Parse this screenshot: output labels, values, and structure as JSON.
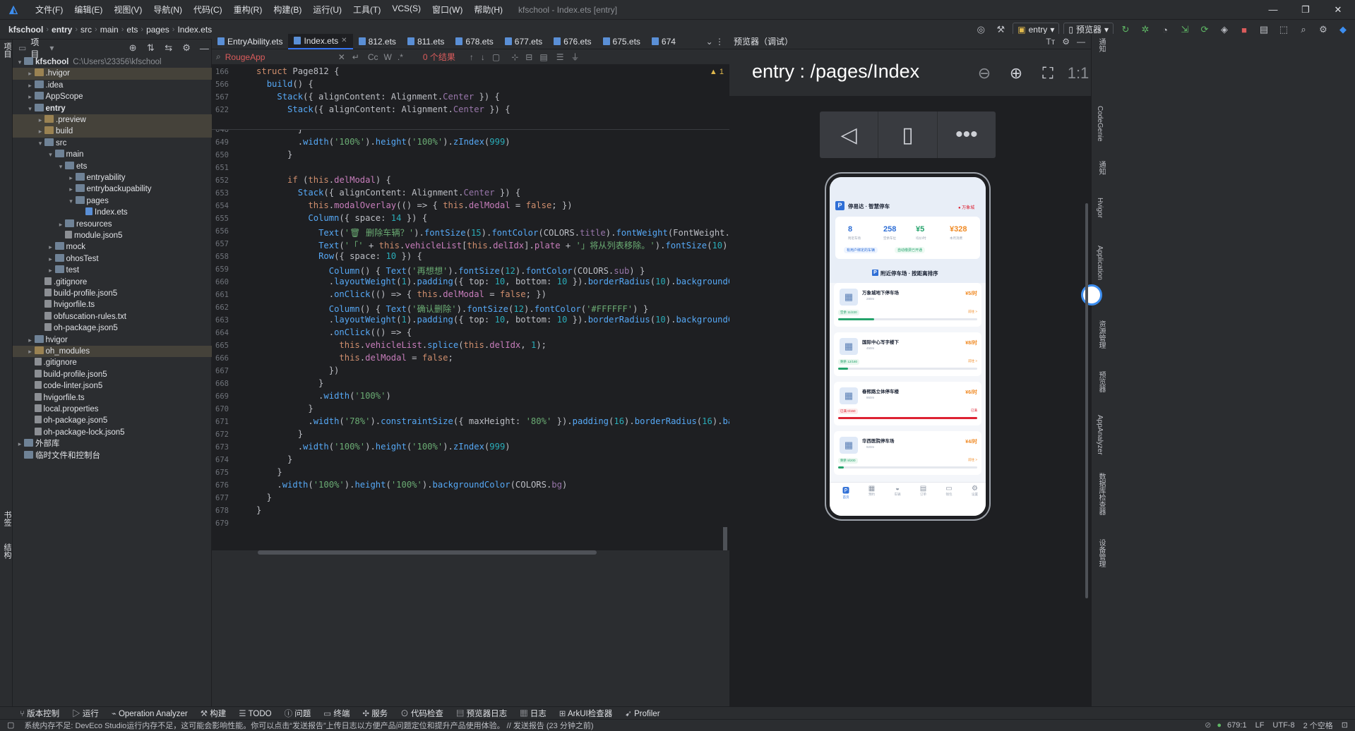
{
  "menu": [
    "文件(F)",
    "编辑(E)",
    "视图(V)",
    "导航(N)",
    "代码(C)",
    "重构(R)",
    "构建(B)",
    "运行(U)",
    "工具(T)",
    "VCS(S)",
    "窗口(W)",
    "帮助(H)"
  ],
  "window_title": "kfschool - Index.ets [entry]",
  "breadcrumb": [
    "kfschool",
    "entry",
    "src",
    "main",
    "ets",
    "pages",
    "Index.ets"
  ],
  "run_config": "entry",
  "previewer_btn": "预览器",
  "project": {
    "header": "项目",
    "tree": [
      {
        "label": "kfschool",
        "extra": "C:\\Users\\23356\\kfschool",
        "level": 0,
        "open": true,
        "type": "folder",
        "bold": true
      },
      {
        "label": ".hvigor",
        "level": 1,
        "type": "folder-o",
        "hl": true
      },
      {
        "label": ".idea",
        "level": 1,
        "type": "folder"
      },
      {
        "label": "AppScope",
        "level": 1,
        "type": "folder"
      },
      {
        "label": "entry",
        "level": 1,
        "open": true,
        "type": "folder",
        "bold": true
      },
      {
        "label": ".preview",
        "level": 2,
        "type": "folder-o",
        "hl": true
      },
      {
        "label": "build",
        "level": 2,
        "type": "folder-o",
        "hl": true
      },
      {
        "label": "src",
        "level": 2,
        "open": true,
        "type": "folder"
      },
      {
        "label": "main",
        "level": 3,
        "open": true,
        "type": "folder"
      },
      {
        "label": "ets",
        "level": 4,
        "open": true,
        "type": "folder"
      },
      {
        "label": "entryability",
        "level": 5,
        "type": "folder"
      },
      {
        "label": "entrybackupability",
        "level": 5,
        "type": "folder"
      },
      {
        "label": "pages",
        "level": 5,
        "open": true,
        "type": "folder"
      },
      {
        "label": "Index.ets",
        "level": 6,
        "type": "file-ets",
        "leaf": true
      },
      {
        "label": "resources",
        "level": 4,
        "type": "folder"
      },
      {
        "label": "module.json5",
        "level": 4,
        "type": "file",
        "leaf": true
      },
      {
        "label": "mock",
        "level": 3,
        "type": "folder"
      },
      {
        "label": "ohosTest",
        "level": 3,
        "type": "folder"
      },
      {
        "label": "test",
        "level": 3,
        "type": "folder"
      },
      {
        "label": ".gitignore",
        "level": 2,
        "type": "file",
        "leaf": true
      },
      {
        "label": "build-profile.json5",
        "level": 2,
        "type": "file",
        "leaf": true
      },
      {
        "label": "hvigorfile.ts",
        "level": 2,
        "type": "file",
        "leaf": true
      },
      {
        "label": "obfuscation-rules.txt",
        "level": 2,
        "type": "file",
        "leaf": true
      },
      {
        "label": "oh-package.json5",
        "level": 2,
        "type": "file",
        "leaf": true
      },
      {
        "label": "hvigor",
        "level": 1,
        "type": "folder"
      },
      {
        "label": "oh_modules",
        "level": 1,
        "type": "folder-o",
        "hl": true
      },
      {
        "label": ".gitignore",
        "level": 1,
        "type": "file",
        "leaf": true
      },
      {
        "label": "build-profile.json5",
        "level": 1,
        "type": "file",
        "leaf": true
      },
      {
        "label": "code-linter.json5",
        "level": 1,
        "type": "file",
        "leaf": true
      },
      {
        "label": "hvigorfile.ts",
        "level": 1,
        "type": "file",
        "leaf": true
      },
      {
        "label": "local.properties",
        "level": 1,
        "type": "file",
        "leaf": true
      },
      {
        "label": "oh-package.json5",
        "level": 1,
        "type": "file",
        "leaf": true
      },
      {
        "label": "oh-package-lock.json5",
        "level": 1,
        "type": "file",
        "leaf": true
      },
      {
        "label": "外部库",
        "level": 0,
        "type": "folder"
      },
      {
        "label": "临时文件和控制台",
        "level": 0,
        "type": "folder",
        "leaf": true
      }
    ]
  },
  "tabs": [
    "EntryAbility.ets",
    "Index.ets",
    "812.ets",
    "811.ets",
    "678.ets",
    "677.ets",
    "676.ets",
    "675.ets",
    "674"
  ],
  "active_tab": 1,
  "search": {
    "value": "RougeApp",
    "results": "0 个结果",
    "problems": "1"
  },
  "sticky_lines": [
    {
      "num": "166",
      "html": "<span class=\"k\">struct</span> <span class=\"f\" style=\"color:#bcbec4\">Page812</span> {"
    },
    {
      "num": "566",
      "html": "  <span class=\"f\">build</span>() {"
    },
    {
      "num": "567",
      "html": "    <span class=\"f\">Stack</span>({ alignContent: Alignment.<span class=\"t\">Center</span> }) {"
    },
    {
      "num": "622",
      "html": "      <span class=\"f\">Stack</span>({ alignContent: Alignment.<span class=\"t\">Center</span> }) {"
    }
  ],
  "code_lines": [
    {
      "num": "648",
      "html": "        }"
    },
    {
      "num": "649",
      "html": "        .<span class=\"f\">width</span>(<span class=\"s\">'100%'</span>).<span class=\"f\">height</span>(<span class=\"s\">'100%'</span>).<span class=\"f\">zIndex</span>(<span class=\"n\">999</span>)"
    },
    {
      "num": "650",
      "html": "      }"
    },
    {
      "num": "651",
      "html": ""
    },
    {
      "num": "652",
      "html": "      <span class=\"k\">if</span> (<span class=\"k\">this</span>.<span class=\"p\">delModal</span>) {"
    },
    {
      "num": "653",
      "html": "        <span class=\"f\">Stack</span>({ alignContent: Alignment.<span class=\"t\">Center</span> }) {"
    },
    {
      "num": "654",
      "html": "          <span class=\"k\">this</span>.<span class=\"p\">modalOverlay</span>(() => { <span class=\"k\">this</span>.<span class=\"p\">delModal</span> = <span class=\"k\">false</span>; })"
    },
    {
      "num": "655",
      "html": "          <span class=\"f\">Column</span>({ space: <span class=\"n\">14</span> }) {"
    },
    {
      "num": "656",
      "html": "            <span class=\"f\">Text</span>(<span class=\"s\">'🗑 删除车辆？'</span>).<span class=\"f\">fontSize</span>(<span class=\"n\">15</span>).<span class=\"f\">fontColor</span>(COLORS.<span class=\"t\">title</span>).<span class=\"f\">fontWeight</span>(FontWeight.<span class=\"t\">Bold</span>)"
    },
    {
      "num": "657",
      "html": "            <span class=\"f\">Text</span>(<span class=\"s\">'「'</span> + <span class=\"k\">this</span>.<span class=\"p\">vehicleList</span>[<span class=\"k\">this</span>.<span class=\"p\">delIdx</span>].<span class=\"p\">plate</span> + <span class=\"s\">'」将从列表移除。'</span>).<span class=\"f\">fontSize</span>(<span class=\"n\">10</span>).<span class=\"f\">fontColor</span>(C"
    },
    {
      "num": "658",
      "html": "            <span class=\"f\">Row</span>({ space: <span class=\"n\">10</span> }) {"
    },
    {
      "num": "659",
      "html": "              <span class=\"f\">Column</span>() { <span class=\"f\">Text</span>(<span class=\"s\">'再想想'</span>).<span class=\"f\">fontSize</span>(<span class=\"n\">12</span>).<span class=\"f\">fontColor</span>(COLORS.<span class=\"t\">sub</span>) }"
    },
    {
      "num": "660",
      "html": "              .<span class=\"f\">layoutWeight</span>(<span class=\"n\">1</span>).<span class=\"f\">padding</span>({ top: <span class=\"n\">10</span>, bottom: <span class=\"n\">10</span> }).<span class=\"f\">borderRadius</span>(<span class=\"n\">10</span>).<span class=\"f\">backgroundColor</span>(COLORS"
    },
    {
      "num": "661",
      "html": "              .<span class=\"f\">onClick</span>(() => { <span class=\"k\">this</span>.<span class=\"p\">delModal</span> = <span class=\"k\">false</span>; })"
    },
    {
      "num": "662",
      "html": "              <span class=\"f\">Column</span>() { <span class=\"f\">Text</span>(<span class=\"s\">'确认删除'</span>).<span class=\"f\">fontSize</span>(<span class=\"n\">12</span>).<span class=\"f\">fontColor</span>(<span class=\"s\">'#FFFFFF'</span>) }"
    },
    {
      "num": "663",
      "html": "              .<span class=\"f\">layoutWeight</span>(<span class=\"n\">1</span>).<span class=\"f\">padding</span>({ top: <span class=\"n\">10</span>, bottom: <span class=\"n\">10</span> }).<span class=\"f\">borderRadius</span>(<span class=\"n\">10</span>).<span class=\"f\">backgroundColor</span>(COLORS"
    },
    {
      "num": "664",
      "html": "              .<span class=\"f\">onClick</span>(() => {"
    },
    {
      "num": "665",
      "html": "                <span class=\"k\">this</span>.<span class=\"p\">vehicleList</span>.<span class=\"f\">splice</span>(<span class=\"k\">this</span>.<span class=\"p\">delIdx</span>, <span class=\"n\">1</span>);"
    },
    {
      "num": "666",
      "html": "                <span class=\"k\">this</span>.<span class=\"p\">delModal</span> = <span class=\"k\">false</span>;"
    },
    {
      "num": "667",
      "html": "              })"
    },
    {
      "num": "668",
      "html": "            }"
    },
    {
      "num": "669",
      "html": "            .<span class=\"f\">width</span>(<span class=\"s\">'100%'</span>)"
    },
    {
      "num": "670",
      "html": "          }"
    },
    {
      "num": "671",
      "html": "          .<span class=\"f\">width</span>(<span class=\"s\">'78%'</span>).<span class=\"f\">constraintSize</span>({ maxHeight: <span class=\"s\">'80%'</span> }).<span class=\"f\">padding</span>(<span class=\"n\">16</span>).<span class=\"f\">borderRadius</span>(<span class=\"n\">16</span>).<span class=\"f\">backgroundCo</span>"
    },
    {
      "num": "672",
      "html": "        }"
    },
    {
      "num": "673",
      "html": "        .<span class=\"f\">width</span>(<span class=\"s\">'100%'</span>).<span class=\"f\">height</span>(<span class=\"s\">'100%'</span>).<span class=\"f\">zIndex</span>(<span class=\"n\">999</span>)"
    },
    {
      "num": "674",
      "html": "      }"
    },
    {
      "num": "675",
      "html": "    }"
    },
    {
      "num": "676",
      "html": "    .<span class=\"f\">width</span>(<span class=\"s\">'100%'</span>).<span class=\"f\">height</span>(<span class=\"s\">'100%'</span>).<span class=\"f\">backgroundColor</span>(COLORS.<span class=\"t\">bg</span>)"
    },
    {
      "num": "677",
      "html": "  }"
    },
    {
      "num": "678",
      "html": "}"
    },
    {
      "num": "679",
      "html": ""
    }
  ],
  "preview": {
    "header": "预览器（调试）",
    "title": "entry : /pages/Index",
    "ratio_label": "1:1",
    "app": {
      "brand": "停易达 · 智慧停车",
      "location": "万象城",
      "stats": [
        {
          "value": "8",
          "label": "附近车场",
          "color": "#2f6fd6"
        },
        {
          "value": "258",
          "label": "空余车位",
          "color": "#2f6fd6"
        },
        {
          "value": "¥5",
          "label": "均价/时",
          "color": "#24a36b"
        },
        {
          "value": "¥328",
          "label": "本月消费",
          "color": "#f08a24"
        }
      ],
      "chips": [
        "有用户绑定的车辆",
        "自动缴费已开通"
      ],
      "section": "附近停车场 · 按距离排序",
      "lots": [
        {
          "name": "万象城地下停车场",
          "price": "¥5/时",
          "meta": "280m",
          "tag": "空余 11/220",
          "status": "前往 >",
          "fill": 0.26
        },
        {
          "name": "国际中心写字楼下",
          "price": "¥8/时",
          "meta": "450m",
          "tag": "剩余 12/180",
          "status": "前往 >",
          "fill": 0.07
        },
        {
          "name": "春熙路立体停车楼",
          "price": "¥6/时",
          "meta": "860m",
          "tag": "已满 0/150",
          "status": "已满",
          "fill": 1.0
        },
        {
          "name": "华西医院停车场",
          "price": "¥4/时",
          "meta": "920m",
          "tag": "剩余 8/200",
          "status": "前往 >",
          "fill": 0.04
        }
      ],
      "nav": [
        "首页",
        "预约",
        "车辆",
        "订单",
        "钱包",
        "设置"
      ]
    }
  },
  "bottom_tools": [
    "版本控制",
    "运行",
    "Operation Analyzer",
    "构建",
    "TODO",
    "问题",
    "终端",
    "服务",
    "代码检查",
    "预览器日志",
    "日志",
    "ArkUI检查器",
    "Profiler"
  ],
  "status": {
    "message": "系统内存不足: DevEco Studio运行内存不足，这可能会影响性能。你可以点击“发送报告”上传日志以方便产品问题定位和提升产品使用体验。 // 发送报告 (23 分钟之前)",
    "position": "679:1",
    "line_sep": "LF",
    "encoding": "UTF-8",
    "indent": "2 个空格"
  },
  "right_tools": [
    "通知",
    "CodeGenie",
    "通知",
    "Hvigor",
    "Application",
    "资源管理",
    "预览器",
    "AppAnalyzer",
    "数据库检查器",
    "设备管理"
  ],
  "left_tools": [
    "项目",
    "书签",
    "结构"
  ]
}
